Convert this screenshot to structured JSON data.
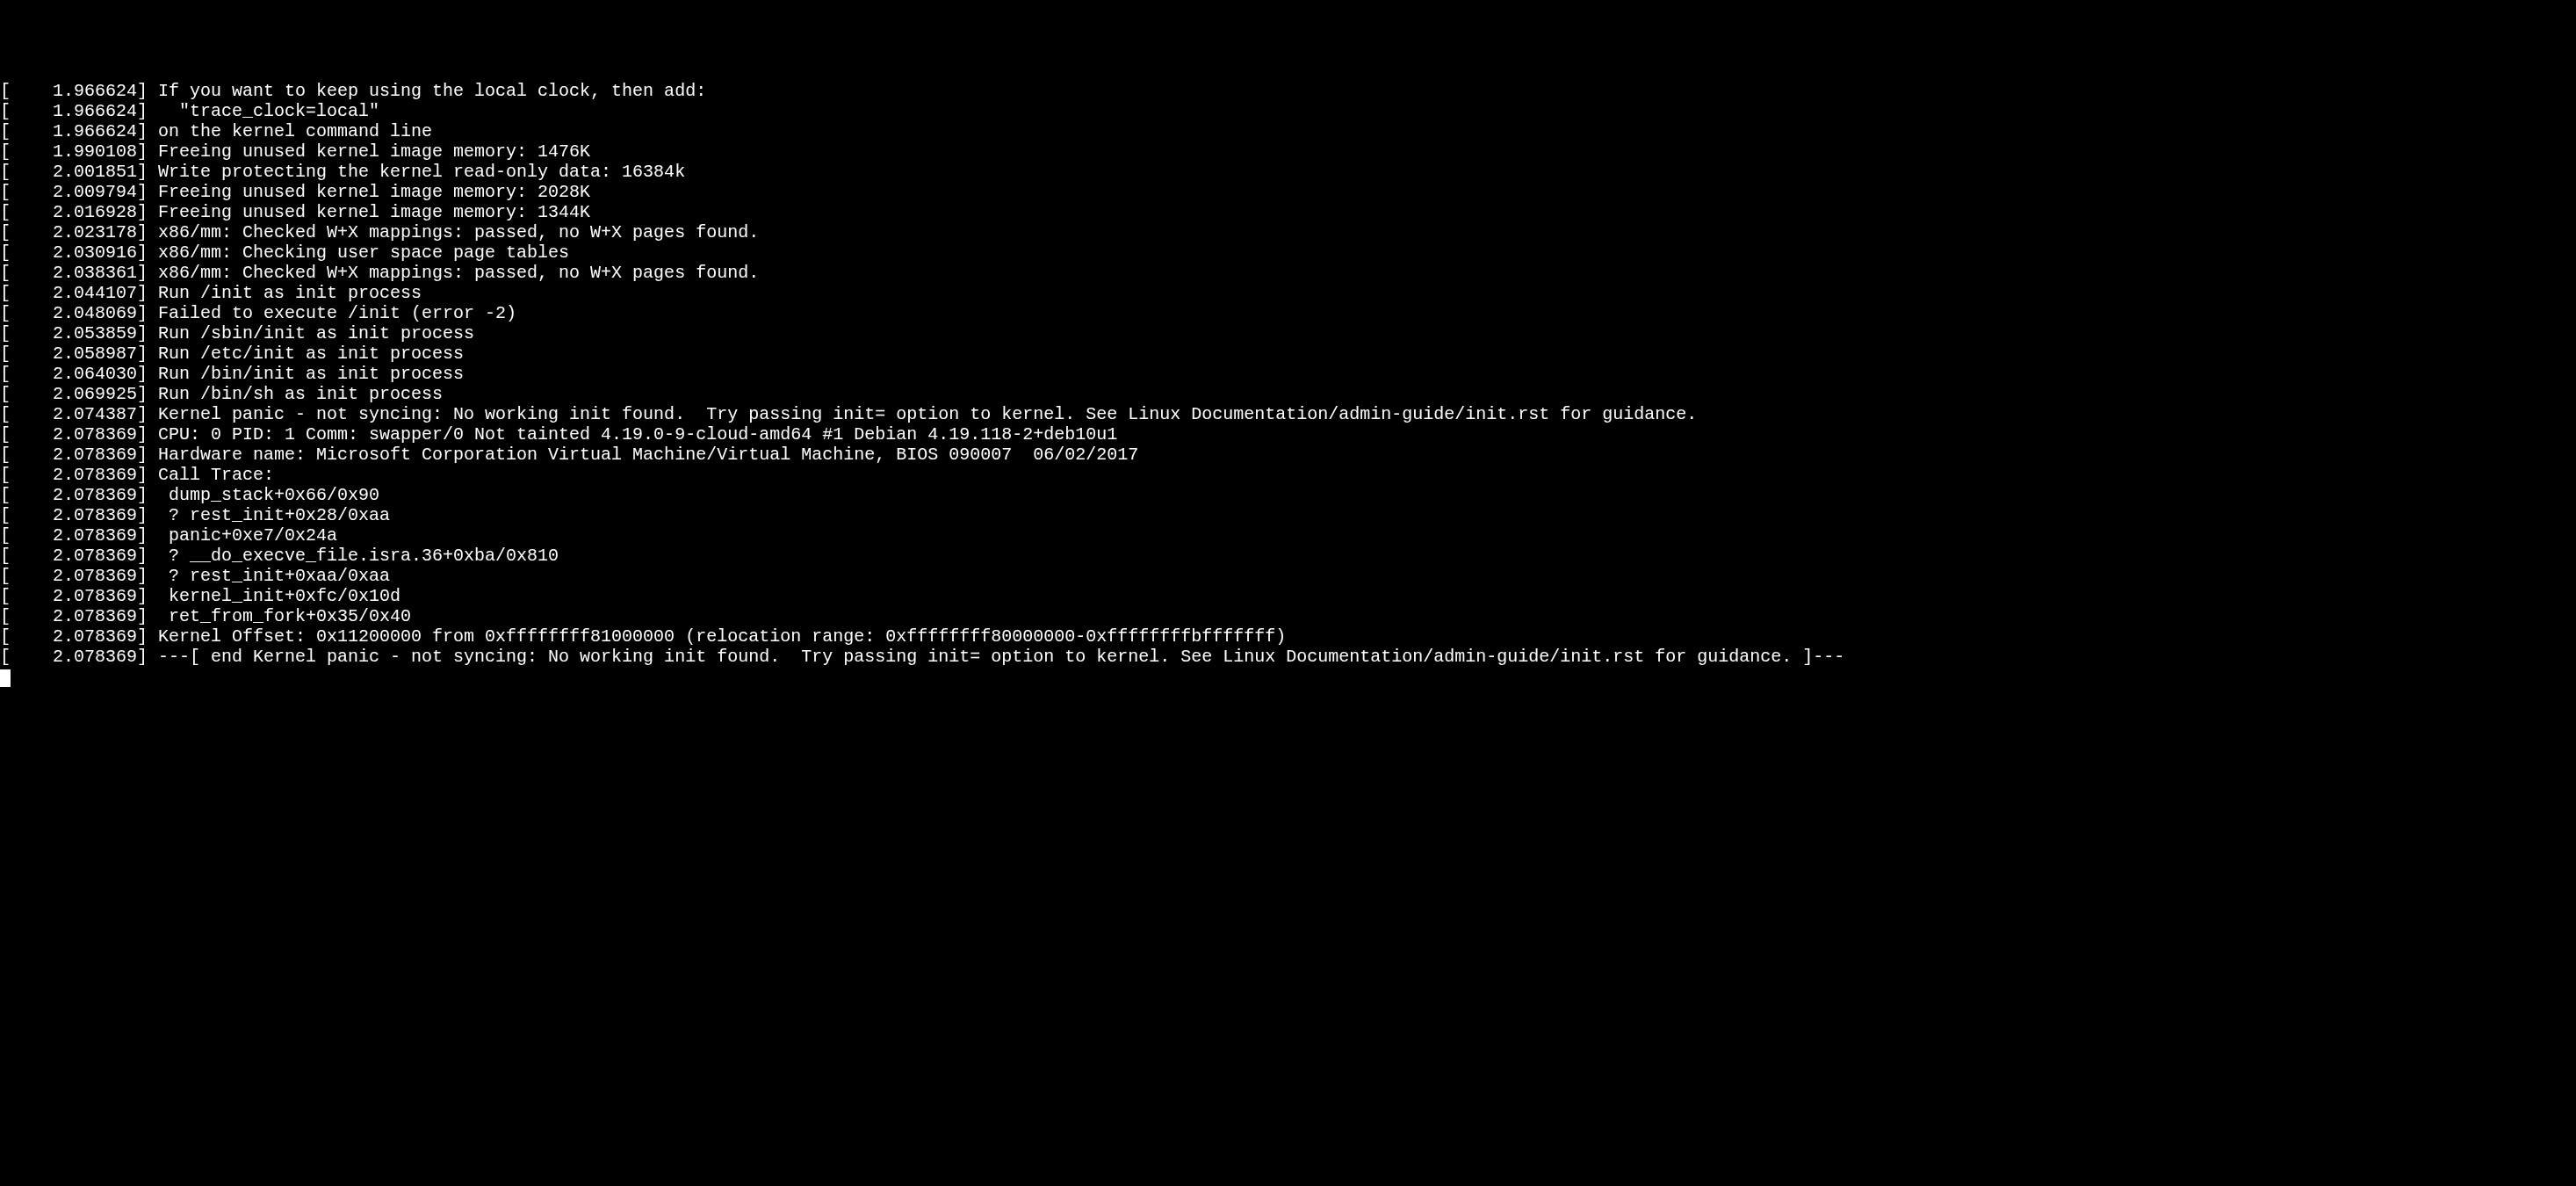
{
  "kernel_log": {
    "lines": [
      {
        "ts": "1.966624",
        "msg": "If you want to keep using the local clock, then add:"
      },
      {
        "ts": "1.966624",
        "msg": "  \"trace_clock=local\""
      },
      {
        "ts": "1.966624",
        "msg": "on the kernel command line"
      },
      {
        "ts": "1.990108",
        "msg": "Freeing unused kernel image memory: 1476K"
      },
      {
        "ts": "2.001851",
        "msg": "Write protecting the kernel read-only data: 16384k"
      },
      {
        "ts": "2.009794",
        "msg": "Freeing unused kernel image memory: 2028K"
      },
      {
        "ts": "2.016928",
        "msg": "Freeing unused kernel image memory: 1344K"
      },
      {
        "ts": "2.023178",
        "msg": "x86/mm: Checked W+X mappings: passed, no W+X pages found."
      },
      {
        "ts": "2.030916",
        "msg": "x86/mm: Checking user space page tables"
      },
      {
        "ts": "2.038361",
        "msg": "x86/mm: Checked W+X mappings: passed, no W+X pages found."
      },
      {
        "ts": "2.044107",
        "msg": "Run /init as init process"
      },
      {
        "ts": "2.048069",
        "msg": "Failed to execute /init (error -2)"
      },
      {
        "ts": "2.053859",
        "msg": "Run /sbin/init as init process"
      },
      {
        "ts": "2.058987",
        "msg": "Run /etc/init as init process"
      },
      {
        "ts": "2.064030",
        "msg": "Run /bin/init as init process"
      },
      {
        "ts": "2.069925",
        "msg": "Run /bin/sh as init process"
      },
      {
        "ts": "2.074387",
        "msg": "Kernel panic - not syncing: No working init found.  Try passing init= option to kernel. See Linux Documentation/admin-guide/init.rst for guidance."
      },
      {
        "ts": "2.078369",
        "msg": "CPU: 0 PID: 1 Comm: swapper/0 Not tainted 4.19.0-9-cloud-amd64 #1 Debian 4.19.118-2+deb10u1"
      },
      {
        "ts": "2.078369",
        "msg": "Hardware name: Microsoft Corporation Virtual Machine/Virtual Machine, BIOS 090007  06/02/2017"
      },
      {
        "ts": "2.078369",
        "msg": "Call Trace:"
      },
      {
        "ts": "2.078369",
        "msg": " dump_stack+0x66/0x90"
      },
      {
        "ts": "2.078369",
        "msg": " ? rest_init+0x28/0xaa"
      },
      {
        "ts": "2.078369",
        "msg": " panic+0xe7/0x24a"
      },
      {
        "ts": "2.078369",
        "msg": " ? __do_execve_file.isra.36+0xba/0x810"
      },
      {
        "ts": "2.078369",
        "msg": " ? rest_init+0xaa/0xaa"
      },
      {
        "ts": "2.078369",
        "msg": " kernel_init+0xfc/0x10d"
      },
      {
        "ts": "2.078369",
        "msg": " ret_from_fork+0x35/0x40"
      },
      {
        "ts": "2.078369",
        "msg": "Kernel Offset: 0x11200000 from 0xffffffff81000000 (relocation range: 0xffffffff80000000-0xffffffffbfffffff)"
      },
      {
        "ts": "2.078369",
        "msg": "---[ end Kernel panic - not syncing: No working init found.  Try passing init= option to kernel. See Linux Documentation/admin-guide/init.rst for guidance. ]---"
      }
    ]
  }
}
